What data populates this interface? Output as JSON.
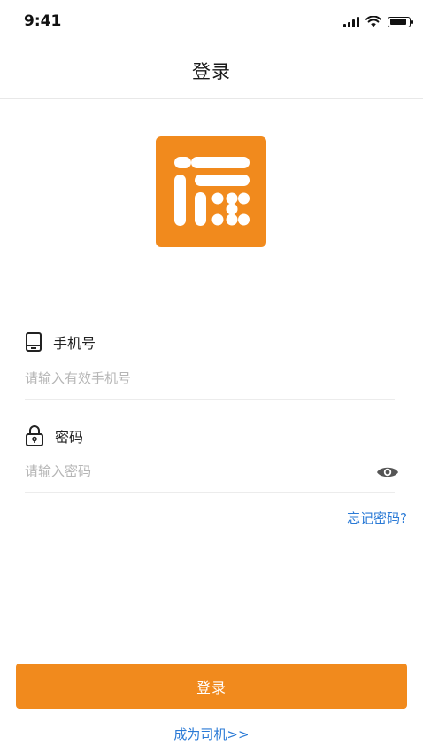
{
  "status_bar": {
    "time": "9:41",
    "signal_icon": "cellular-signal-icon",
    "wifi_icon": "wifi-icon",
    "battery_icon": "battery-icon",
    "battery_level": 0.9
  },
  "nav": {
    "title": "登录"
  },
  "logo": {
    "icon": "app-logo-icon",
    "color": "#f18a1d"
  },
  "phone": {
    "icon": "phone-icon",
    "label": "手机号",
    "placeholder": "请输入有效手机号",
    "value": ""
  },
  "password": {
    "icon": "lock-icon",
    "label": "密码",
    "placeholder": "请输入密码",
    "value": "",
    "toggle_icon": "eye-icon"
  },
  "forgot_password": "忘记密码?",
  "login_button": "登录",
  "become_driver": "成为司机>>",
  "colors": {
    "accent": "#f18a1d",
    "link": "#2a7ad6"
  }
}
